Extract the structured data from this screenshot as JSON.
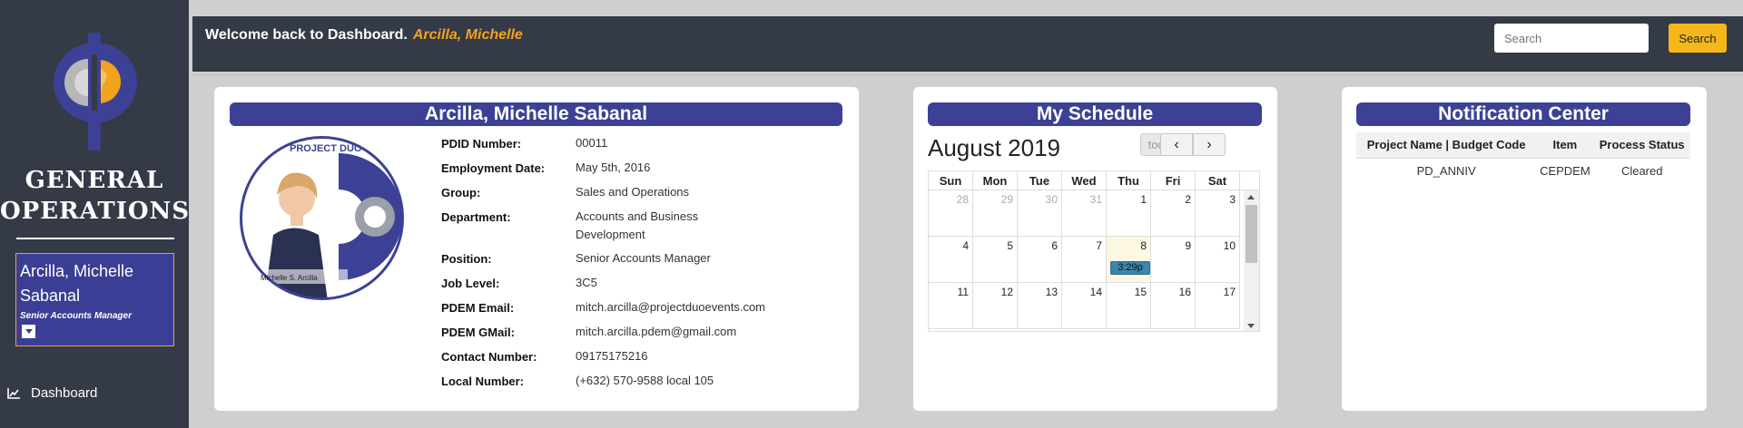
{
  "sidebar": {
    "brand_line1": "GENERAL",
    "brand_line2": "OPERATIONS",
    "user_name": "Arcilla, Michelle Sabanal",
    "user_position": "Senior Accounts Manager",
    "nav": [
      {
        "label": "Dashboard",
        "icon": "line-chart-icon"
      }
    ]
  },
  "header": {
    "welcome_text": "Welcome back to Dashboard.",
    "welcome_name": "Arcilla, Michelle",
    "search_placeholder": "Search",
    "search_button": "Search"
  },
  "colors": {
    "accent": "#3c4195",
    "header": "#343a46",
    "highlight": "#f2a31c",
    "search_button": "#f5b81a"
  },
  "profile": {
    "title": "Arcilla, Michelle Sabanal",
    "photo_caption": "Michelle S. Arcilla",
    "photo_brand": "PROJECT DUO",
    "fields": [
      {
        "label": "PDID Number:",
        "value": "00011"
      },
      {
        "label": "Employment Date:",
        "value": "May 5th, 2016"
      },
      {
        "label": "Group:",
        "value": "Sales and Operations"
      },
      {
        "label": "Department:",
        "value": "Accounts and Business Development"
      },
      {
        "label": "Position:",
        "value": "Senior Accounts Manager"
      },
      {
        "label": "Job Level:",
        "value": "3C5"
      },
      {
        "label": "PDEM Email:",
        "value": "mitch.arcilla@projectduoevents.com"
      },
      {
        "label": "PDEM GMail:",
        "value": "mitch.arcilla.pdem@gmail.com"
      },
      {
        "label": "Contact Number:",
        "value": "09175175216"
      },
      {
        "label": "Local Number:",
        "value": "(+632) 570-9588 local 105"
      }
    ]
  },
  "schedule": {
    "title": "My Schedule",
    "month": "August 2019",
    "today_button": "today",
    "prev_icon": "chevron-left-icon",
    "next_icon": "chevron-right-icon",
    "weekdays": [
      "Sun",
      "Mon",
      "Tue",
      "Wed",
      "Thu",
      "Fri",
      "Sat"
    ],
    "weeks": [
      [
        "28",
        "29",
        "30",
        "31",
        "1",
        "2",
        "3"
      ],
      [
        "4",
        "5",
        "6",
        "7",
        "8",
        "9",
        "10"
      ],
      [
        "11",
        "12",
        "13",
        "14",
        "15",
        "16",
        "17"
      ]
    ],
    "event": {
      "date": "8",
      "label": "3:29p"
    }
  },
  "notifications": {
    "title": "Notification Center",
    "columns": [
      "Project Name | Budget Code",
      "Item",
      "Process Status"
    ],
    "rows": [
      [
        "PD_ANNIV",
        "CEPDEM",
        "Cleared"
      ]
    ]
  }
}
